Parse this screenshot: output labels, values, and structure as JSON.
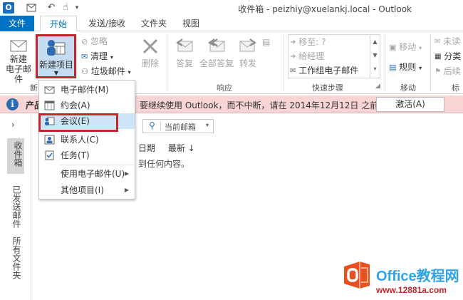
{
  "window": {
    "title": "收件箱 - peizhiy@xuelankj.local - Outlook"
  },
  "tabs": [
    {
      "label": "文件"
    },
    {
      "label": "开始"
    },
    {
      "label": "发送/接收"
    },
    {
      "label": "文件夹"
    },
    {
      "label": "视图"
    }
  ],
  "ribbon": {
    "new_email": "新建\n电子邮件",
    "new_email_l1": "新建",
    "new_email_l2": "电子邮件",
    "new_items": "新建项目",
    "ignore": "忽略",
    "cleanup": "清理",
    "junk": "垃圾邮件",
    "delete": "删除",
    "reply": "答复",
    "reply_all": "全部答复",
    "forward": "转发",
    "quickstep_move": "移至: ?",
    "quickstep_manager": "给经理",
    "quickstep_team": "工作组电子邮件",
    "move": "移动",
    "rules": "规则",
    "unread": "未读",
    "categorize": "分类",
    "followup": "后续",
    "group_new": "新",
    "group_respond": "响应",
    "group_quicksteps": "快速步骤",
    "group_move": "移动",
    "group_tags": "标"
  },
  "infobar": {
    "prefix": "产品",
    "message": "要继续使用 Outlook，而不中断，请在 2014年12月12日 之前激活。",
    "activate_button": "激活(A)"
  },
  "leftnav": {
    "items": [
      {
        "label": "收件箱"
      },
      {
        "label": "已发送邮件"
      },
      {
        "label": "所有文件夹"
      }
    ]
  },
  "mail": {
    "search_scope": "当前邮箱",
    "sort_by": "日期",
    "sort_order": "最新",
    "empty_text": "找不到任何内容。",
    "empty_text_visible": "到任何内容。"
  },
  "menu": {
    "items": [
      {
        "label": "电子邮件(M)"
      },
      {
        "label": "约会(A)"
      },
      {
        "label": "会议(E)"
      },
      {
        "label": "联系人(C)"
      },
      {
        "label": "任务(T)"
      },
      {
        "label": "使用电子邮件(U)"
      },
      {
        "label": "其他项目(I)"
      }
    ]
  },
  "watermark": {
    "title": "Office教程网",
    "url": "www.office26.com",
    "url2": "www.12881a.com"
  },
  "colors": {
    "accent": "#0072c6",
    "highlight_red": "#c4242b",
    "infobar_bg": "#f8d4d4",
    "menu_selected": "#cde6f7"
  }
}
